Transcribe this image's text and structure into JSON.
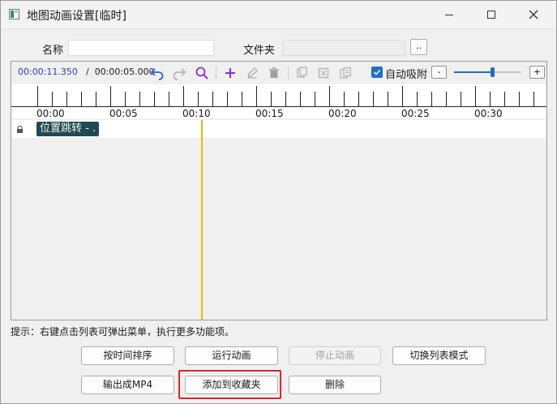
{
  "window": {
    "title": "地图动画设置[临时]"
  },
  "form": {
    "name_label": "名称",
    "name_value": "",
    "folder_label": "文件夹",
    "folder_value": "",
    "browse_label": ".."
  },
  "toolbar": {
    "current_time": "00:00:11.350",
    "separator": "/",
    "total_time": "00:00:05.000",
    "icons": [
      "undo-icon",
      "redo-icon",
      "search-icon",
      "add-icon",
      "edit-icon",
      "delete-icon",
      "copy-icon",
      "paste-icon",
      "duplicate-icon"
    ],
    "snap_label": "自动吸附",
    "snap_checked": true,
    "zoom_out_label": "-",
    "zoom_in_label": "+",
    "zoom_level": 0.58
  },
  "ruler": {
    "labels": [
      "00:00",
      "00:05",
      "00:10",
      "00:15",
      "00:20",
      "00:25",
      "00:30"
    ]
  },
  "track": {
    "clip_label": "位置跳转 - ."
  },
  "hint": "提示：右键点击列表可弹出菜单，执行更多功能项。",
  "buttons": {
    "sort_by_time": "按时间排序",
    "run_animation": "运行动画",
    "stop_animation": "停止动画",
    "toggle_list_mode": "切换列表模式",
    "export_mp4": "输出成MP4",
    "add_to_favorites": "添加到收藏夹",
    "delete": "删除"
  },
  "colors": {
    "accent": "#1e6fc7",
    "time_text": "#2a3fae",
    "playhead": "#f2b705",
    "clip_bg": "#1f4a50",
    "highlight": "#d7262c",
    "icon_blue": "#2b63d9",
    "icon_purple": "#8a2be2"
  }
}
